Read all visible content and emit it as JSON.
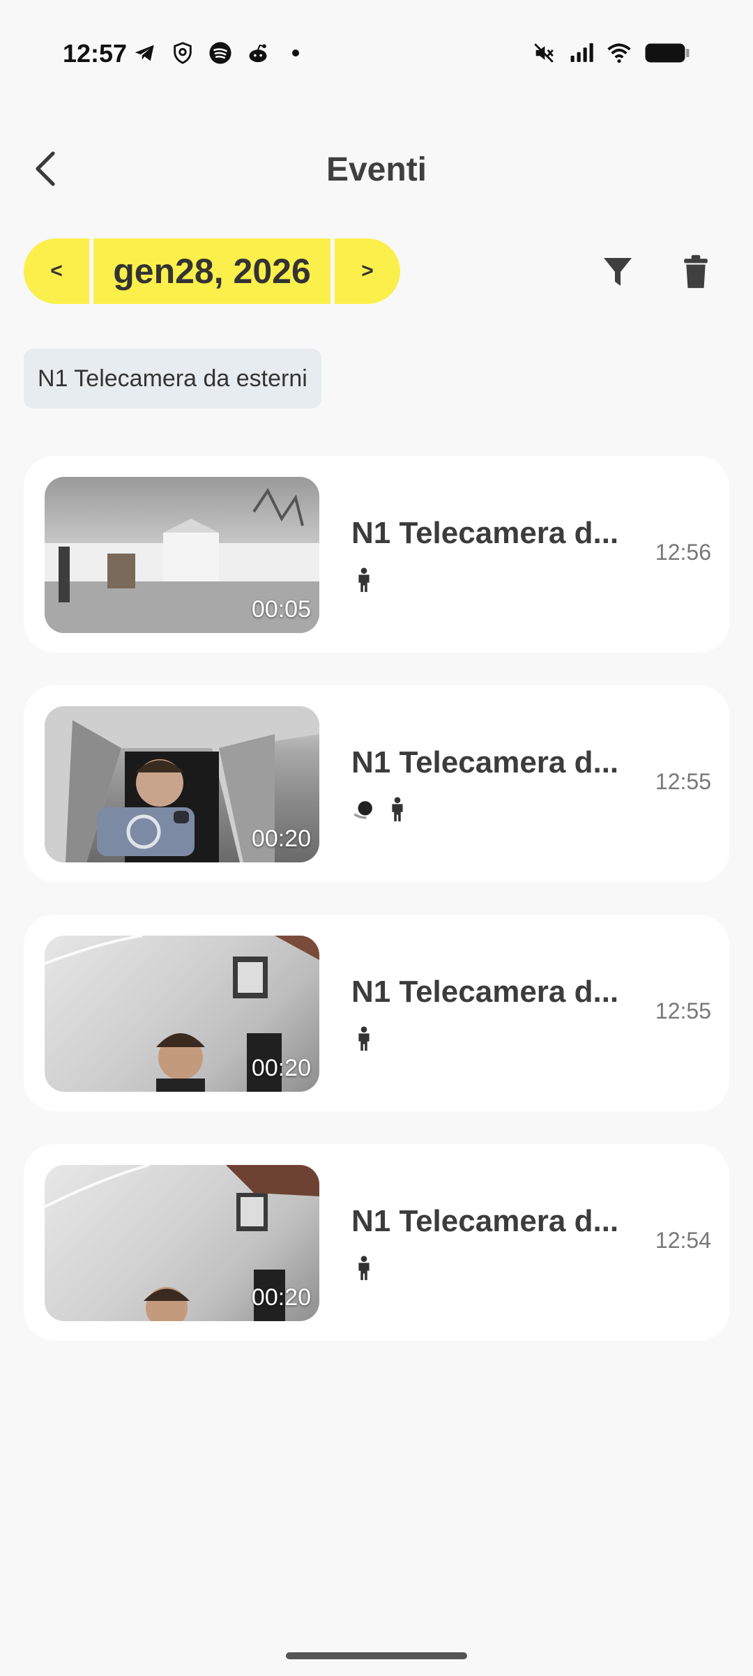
{
  "status_bar": {
    "time": "12:57",
    "left_icons": [
      "telegram-icon",
      "shield-icon",
      "spotify-icon",
      "reddit-icon",
      "dot-icon"
    ],
    "right_icons": [
      "mute-icon",
      "signal-icon",
      "wifi-icon",
      "battery-icon"
    ]
  },
  "header": {
    "title": "Eventi",
    "back_icon": "chevron-left-icon"
  },
  "date_nav": {
    "prev_label": "<",
    "date_label": "gen28, 2026",
    "next_label": ">",
    "accent_color": "#fbef4b"
  },
  "actions": {
    "filter_icon": "filter-icon",
    "delete_icon": "trash-icon"
  },
  "camera_filter": {
    "label": "N1 Telecamera da esterni"
  },
  "events": [
    {
      "title": "N1 Telecamera d...",
      "time": "12:56",
      "duration": "00:05",
      "icons": [
        "person-icon"
      ]
    },
    {
      "title": "N1 Telecamera d...",
      "time": "12:55",
      "duration": "00:20",
      "icons": [
        "motion-icon",
        "person-icon"
      ]
    },
    {
      "title": "N1 Telecamera d...",
      "time": "12:55",
      "duration": "00:20",
      "icons": [
        "person-icon"
      ]
    },
    {
      "title": "N1 Telecamera d...",
      "time": "12:54",
      "duration": "00:20",
      "icons": [
        "person-icon"
      ]
    }
  ]
}
